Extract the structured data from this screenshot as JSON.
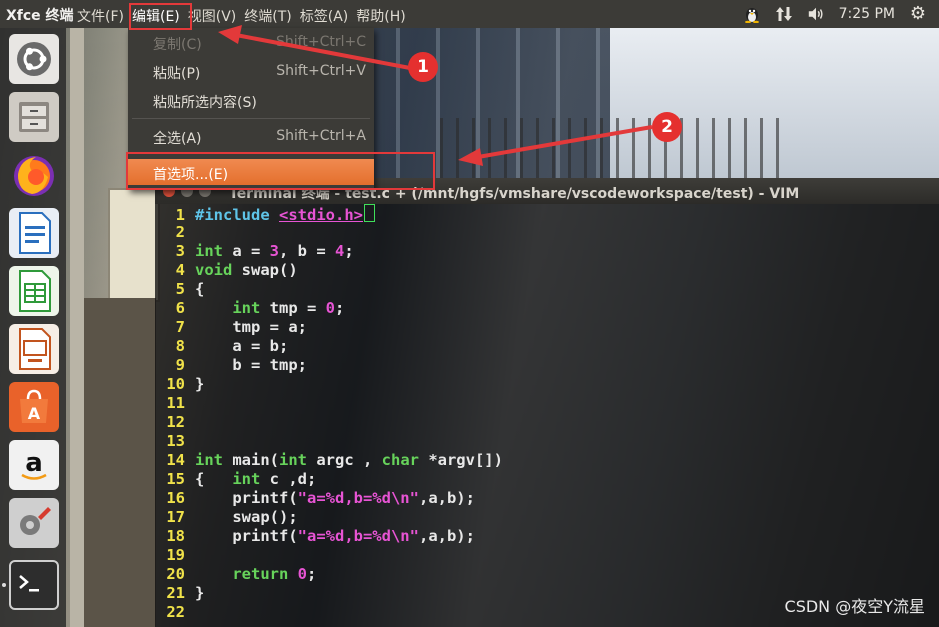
{
  "top_panel": {
    "app_title": "Xfce 终端",
    "menus": [
      "文件(F)",
      "编辑(E)",
      "视图(V)",
      "终端(T)",
      "标签(A)",
      "帮助(H)"
    ],
    "time": "7:25 PM"
  },
  "edit_menu": {
    "items": [
      {
        "label": "复制(C)",
        "accel": "Shift+Ctrl+C"
      },
      {
        "label": "粘贴(P)",
        "accel": "Shift+Ctrl+V"
      },
      {
        "label": "粘贴所选内容(S)",
        "accel": ""
      },
      {
        "label": "全选(A)",
        "accel": "Shift+Ctrl+A"
      },
      {
        "label": "首选项...(E)",
        "accel": ""
      }
    ]
  },
  "terminal": {
    "title": "Terminal 终端 - test.c + (/mnt/hgfs/vmshare/vscodeworkspace/test) - VIM"
  },
  "code_lines": [
    {
      "n": "1",
      "text": "#include <stdio.h>"
    },
    {
      "n": "2",
      "text": ""
    },
    {
      "n": "3",
      "text": "int a = 3, b = 4;"
    },
    {
      "n": "4",
      "text": "void swap()"
    },
    {
      "n": "5",
      "text": "{"
    },
    {
      "n": "6",
      "text": "    int tmp = 0;"
    },
    {
      "n": "7",
      "text": "    tmp = a;"
    },
    {
      "n": "8",
      "text": "    a = b;"
    },
    {
      "n": "9",
      "text": "    b = tmp;"
    },
    {
      "n": "10",
      "text": "}"
    },
    {
      "n": "11",
      "text": ""
    },
    {
      "n": "12",
      "text": ""
    },
    {
      "n": "13",
      "text": ""
    },
    {
      "n": "14",
      "text": "int main(int argc , char *argv[])"
    },
    {
      "n": "15",
      "text": "{   int c ,d;"
    },
    {
      "n": "16",
      "text": "    printf(\"a=%d,b=%d\\n\",a,b);"
    },
    {
      "n": "17",
      "text": "    swap();"
    },
    {
      "n": "18",
      "text": "    printf(\"a=%d,b=%d\\n\",a,b);"
    },
    {
      "n": "19",
      "text": ""
    },
    {
      "n": "20",
      "text": "    return 0;"
    },
    {
      "n": "21",
      "text": "}"
    },
    {
      "n": "22",
      "text": ""
    }
  ],
  "annotations": {
    "badge_1": "1",
    "badge_2": "2"
  },
  "watermark": "CSDN @夜空Y流星",
  "colors": {
    "annotation_red": "#e3393a",
    "menu_highlight": "#e46f2d",
    "line_number": "#f0e24a",
    "keyword": "#5fc4e8",
    "type": "#67d35b",
    "literal": "#e754d4"
  }
}
